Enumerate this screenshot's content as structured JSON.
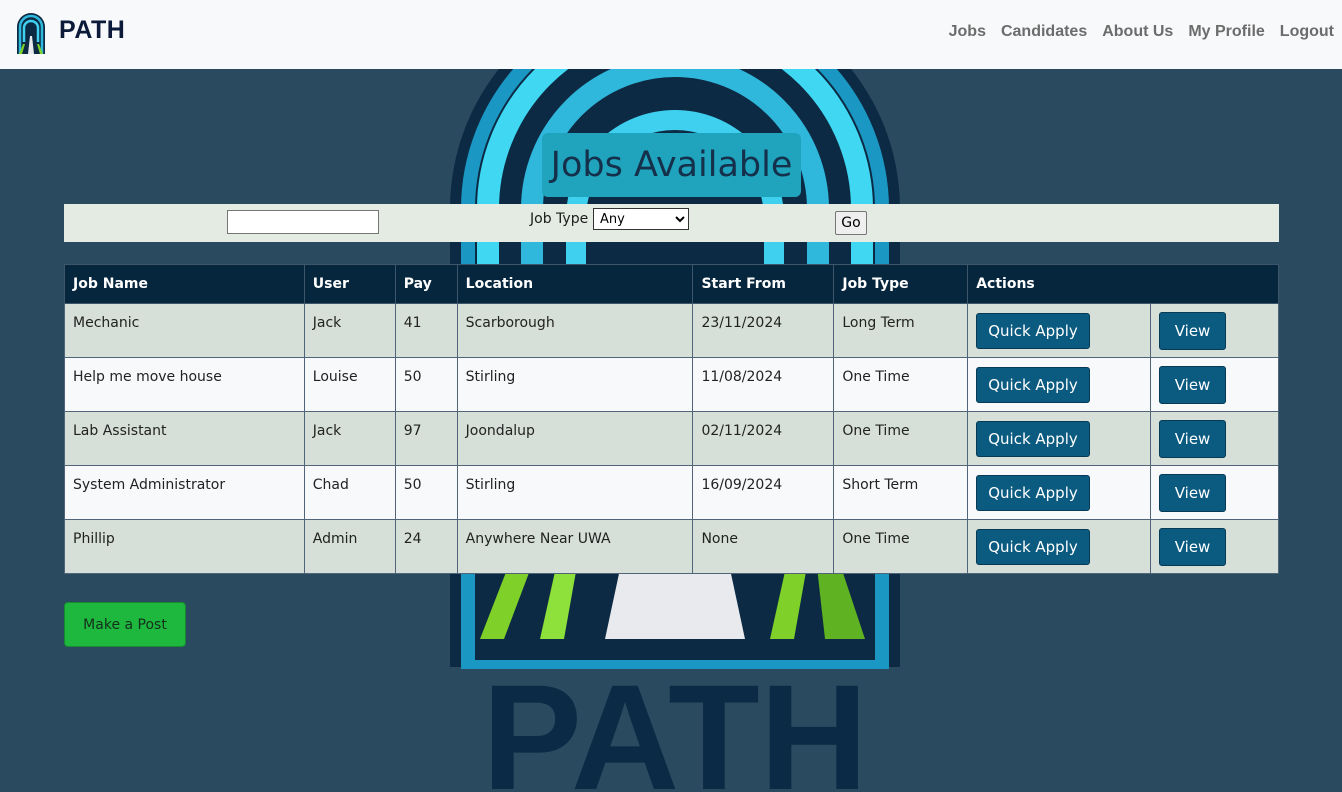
{
  "navbar": {
    "brand": "PATH",
    "links": [
      "Jobs",
      "Candidates",
      "About Us",
      "My Profile",
      "Logout"
    ]
  },
  "background": {
    "logo_text": "PATH"
  },
  "page": {
    "title": "Jobs Available"
  },
  "filters": {
    "search_value": "",
    "job_type_label": "Job Type",
    "job_type_selected": "Any",
    "go_label": "Go"
  },
  "table": {
    "headers": [
      "Job Name",
      "User",
      "Pay",
      "Location",
      "Start From",
      "Job Type",
      "Actions"
    ],
    "rows": [
      {
        "job_name": "Mechanic",
        "user": "Jack",
        "pay": "41",
        "location": "Scarborough",
        "start_from": "23/11/2024",
        "job_type": "Long Term"
      },
      {
        "job_name": "Help me move house",
        "user": "Louise",
        "pay": "50",
        "location": "Stirling",
        "start_from": "11/08/2024",
        "job_type": "One Time"
      },
      {
        "job_name": "Lab Assistant",
        "user": "Jack",
        "pay": "97",
        "location": "Joondalup",
        "start_from": "02/11/2024",
        "job_type": "One Time"
      },
      {
        "job_name": "System Administrator",
        "user": "Chad",
        "pay": "50",
        "location": "Stirling",
        "start_from": "16/09/2024",
        "job_type": "Short Term"
      },
      {
        "job_name": "Phillip",
        "user": "Admin",
        "pay": "24",
        "location": "Anywhere Near UWA",
        "start_from": "None",
        "job_type": "One Time"
      }
    ],
    "quick_apply_label": "Quick Apply",
    "view_label": "View"
  },
  "make_post_label": "Make a Post",
  "colors": {
    "background": "#2a4a60",
    "navbar": "#f8f9fa",
    "heading_box": "#20a4bd",
    "table_header": "#06263e",
    "button_blue": "#0b5a80",
    "button_green": "#1eb83e"
  }
}
